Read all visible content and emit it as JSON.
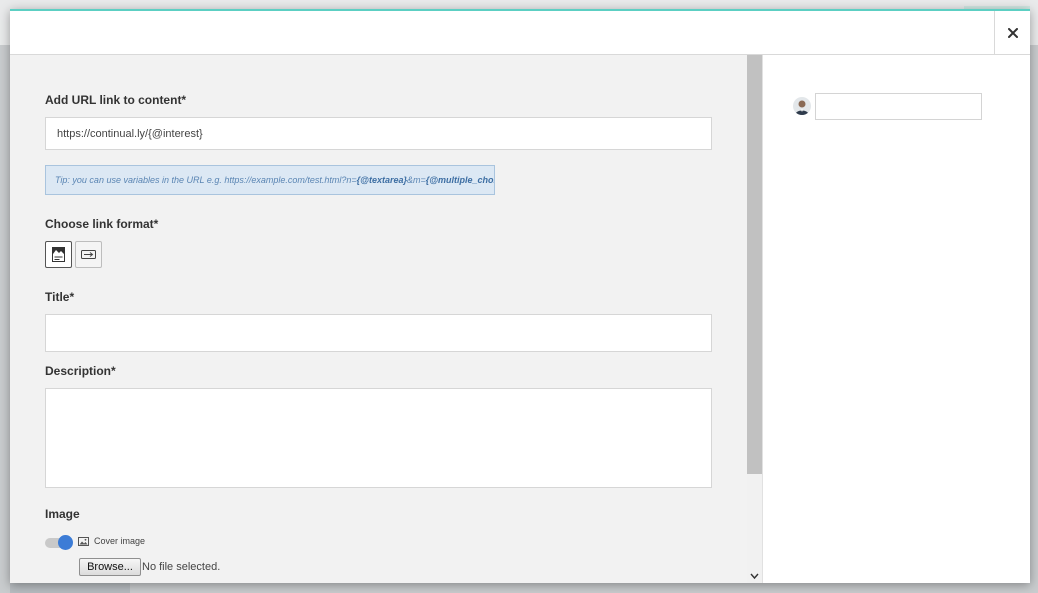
{
  "modal": {
    "close_icon": "close-icon",
    "close_symbol": "×"
  },
  "form": {
    "url_label": "Add URL link to content*",
    "url_value": "https://continual.ly/{@interest}",
    "tip": {
      "prefix": "Tip: you can use variables in the URL e.g. https://example.com/test.html?n=",
      "var1": "{@textarea}",
      "middle": "&m=",
      "var2": "{@multiple_choice}"
    },
    "format_label": "Choose link format*",
    "formats": [
      {
        "icon": "card-format-icon",
        "selected": true
      },
      {
        "icon": "link-button-format-icon",
        "selected": false
      }
    ],
    "title_label": "Title*",
    "title_value": "",
    "description_label": "Description*",
    "description_value": "",
    "image_label": "Image",
    "cover_toggle_on": true,
    "cover_icon": "image-icon",
    "cover_label": "Cover image",
    "browse_label": "Browse...",
    "file_status": "No file selected."
  },
  "sidebar": {
    "avatar_icon": "user-avatar",
    "input_value": ""
  },
  "colors": {
    "accent_top": "#5ccfc3",
    "toggle_on": "#3c7cd6",
    "tip_bg": "#dce8f4",
    "tip_text": "#5a85b3"
  }
}
